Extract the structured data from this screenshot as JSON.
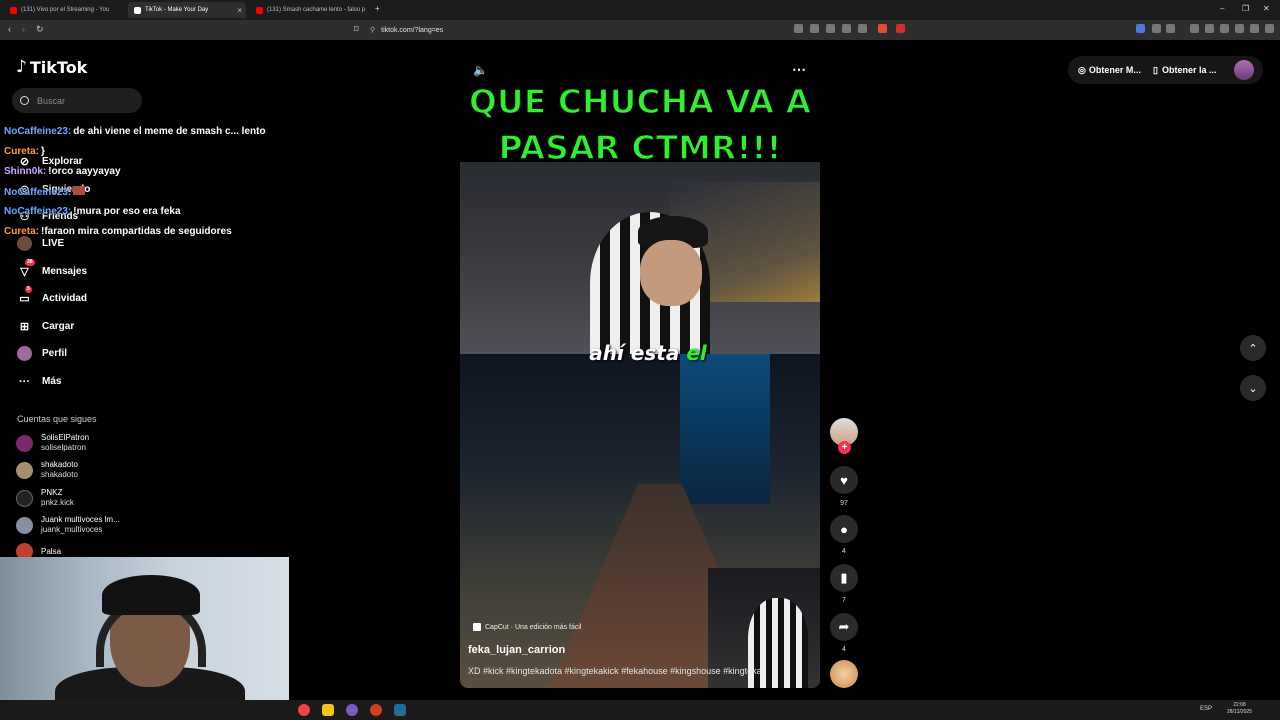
{
  "browser": {
    "tabs": [
      {
        "label": "(131) Vivo por el Streaming - You",
        "color": "#ff0000"
      },
      {
        "label": "TikTok - Make Your Day",
        "color": "#ffffff"
      },
      {
        "label": "(131) Smash cachame lento - falso p",
        "color": "#ff0000"
      }
    ],
    "url": "tiktok.com/?lang=es",
    "new_tab": "+"
  },
  "sidebar": {
    "logo": "TikTok",
    "search_placeholder": "Buscar",
    "items": [
      {
        "label": "Explorar",
        "icon": "compass-icon"
      },
      {
        "label": "Siguiendo",
        "icon": "following-icon"
      },
      {
        "label": "Friends",
        "icon": "friends-icon"
      },
      {
        "label": "LIVE",
        "icon": "live-icon"
      },
      {
        "label": "Mensajes",
        "icon": "message-icon",
        "badge": "38"
      },
      {
        "label": "Actividad",
        "icon": "activity-icon",
        "badge": "5"
      },
      {
        "label": "Cargar",
        "icon": "upload-icon"
      },
      {
        "label": "Perfil",
        "icon": "profile-icon"
      },
      {
        "label": "Más",
        "icon": "more-icon"
      }
    ],
    "follows_title": "Cuentas que sigues",
    "follows": [
      {
        "name": "SolisElPatron",
        "handle": "soliselpatron"
      },
      {
        "name": "shakadoto",
        "handle": "shakadoto"
      },
      {
        "name": "PNKZ",
        "handle": "pnkz.kick"
      },
      {
        "name": "Juank multivoces lm...",
        "handle": "juank_multivoces"
      },
      {
        "name": "Palsa",
        "handle": ""
      }
    ]
  },
  "chat": [
    {
      "user": "NoCaffeine23:",
      "msg": "de ahi viene el meme de smash c... lento",
      "color": "#6fa8ff"
    },
    {
      "user": "Cureta:",
      "msg": "}",
      "color": "#ff9d2e"
    },
    {
      "user": "Shinn0k:",
      "msg": "!orco aayyayay",
      "color": "#c9a8ff"
    },
    {
      "user": "NoCaffeine23:",
      "msg": "",
      "color": "#6fa8ff"
    },
    {
      "user": "NoCaffeine23:",
      "msg": "!mura por eso era feka",
      "color": "#6fa8ff"
    },
    {
      "user": "Cureta:",
      "msg": "!faraon mira compartidas de seguidores",
      "color": "#ff9d2e"
    }
  ],
  "video": {
    "headline_line1": "QUE CHUCHA VA A",
    "headline_line2": "PASAR CTMR!!!",
    "subtitle_main": "ahí esta ",
    "subtitle_hl": "el",
    "capcut": "CapCut · Una edición más fácil",
    "author": "feka_lujan_carrion",
    "caption": "XD #kick #kingtekadota #kingtekakick #fekahouse #kingshouse #kingteka"
  },
  "actions": {
    "likes": "97",
    "comments": "4",
    "saves": "7",
    "shares": "4"
  },
  "header": {
    "get_coins": "Obtener M...",
    "get_app": "Obtener la ..."
  },
  "taskbar": {
    "lang": "ESP",
    "time": "22:08",
    "date": "28/12/2025"
  }
}
